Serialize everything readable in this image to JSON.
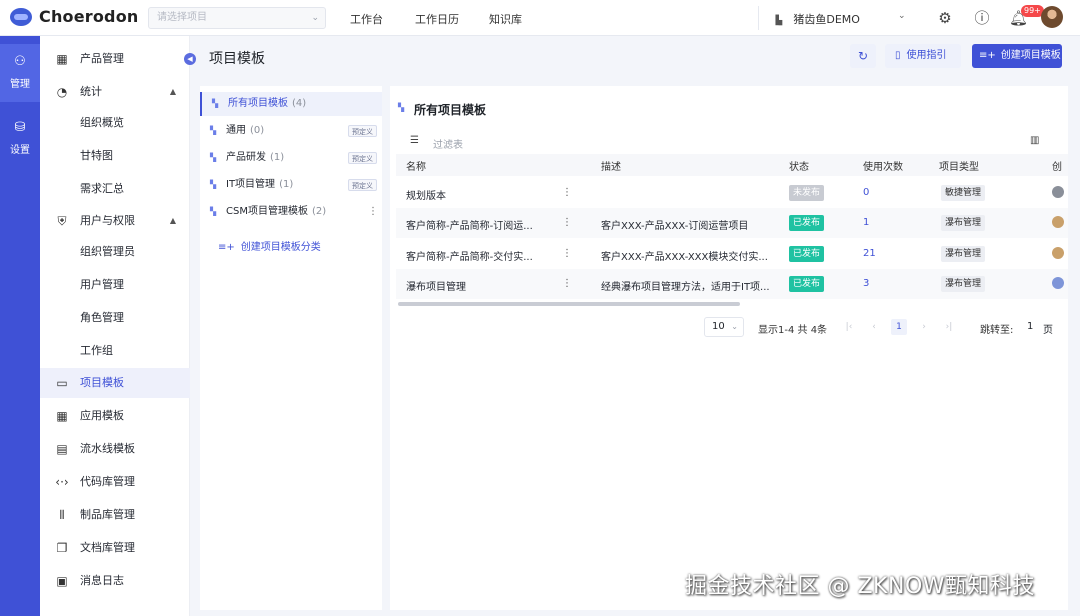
{
  "app": {
    "logo_text": "Choerodon"
  },
  "header": {
    "project_placeholder": "请选择项目",
    "nav": [
      "工作台",
      "工作日历",
      "知识库"
    ],
    "org_name": "猪齿鱼DEMO",
    "notification_count": "99+"
  },
  "rail": {
    "items": [
      {
        "label": "管理"
      },
      {
        "label": "设置"
      }
    ]
  },
  "sidebar": {
    "items": [
      {
        "label": "产品管理",
        "icon": "grid-icon"
      },
      {
        "label": "统计",
        "icon": "chart-icon",
        "expanded": true
      },
      {
        "label": "组织概览"
      },
      {
        "label": "甘特图"
      },
      {
        "label": "需求汇总"
      },
      {
        "label": "用户与权限",
        "icon": "shield-icon",
        "expanded": true
      },
      {
        "label": "组织管理员"
      },
      {
        "label": "用户管理"
      },
      {
        "label": "角色管理"
      },
      {
        "label": "工作组"
      },
      {
        "label": "项目模板",
        "icon": "template-icon",
        "active": true
      },
      {
        "label": "应用模板",
        "icon": "apps-icon"
      },
      {
        "label": "流水线模板",
        "icon": "pipeline-icon"
      },
      {
        "label": "代码库管理",
        "icon": "code-icon"
      },
      {
        "label": "制品库管理",
        "icon": "artifact-icon"
      },
      {
        "label": "文档库管理",
        "icon": "docs-icon"
      },
      {
        "label": "消息日志",
        "icon": "message-icon"
      }
    ]
  },
  "page": {
    "title": "项目模板",
    "refresh_label": "↻",
    "guide_label": "使用指引",
    "create_label": "创建项目模板"
  },
  "categories": {
    "items": [
      {
        "label": "所有项目模板",
        "count": "(4)",
        "active": true
      },
      {
        "label": "通用",
        "count": "(0)",
        "tag": "预定义"
      },
      {
        "label": "产品研发",
        "count": "(1)",
        "tag": "预定义"
      },
      {
        "label": "IT项目管理",
        "count": "(1)",
        "tag": "预定义"
      },
      {
        "label": "CSM项目管理模板",
        "count": "(2)"
      }
    ],
    "add_label": "创建项目模板分类"
  },
  "table": {
    "title": "所有项目模板",
    "filter_placeholder": "过滤表",
    "columns": [
      "名称",
      "描述",
      "状态",
      "使用次数",
      "项目类型",
      "创"
    ],
    "rows": [
      {
        "name": "规划版本",
        "desc": "",
        "status": "未发布",
        "count": "0",
        "type": "敏捷管理"
      },
      {
        "name": "客户简称-产品简称-订阅运...",
        "desc": "客户XXX-产品XXX-订阅运营项目",
        "status": "已发布",
        "count": "1",
        "type": "瀑布管理"
      },
      {
        "name": "客户简称-产品简称-交付实...",
        "desc": "客户XXX-产品XXX-XXX模块交付实...",
        "status": "已发布",
        "count": "21",
        "type": "瀑布管理"
      },
      {
        "name": "瀑布项目管理",
        "desc": "经典瀑布项目管理方法，适用于IT项...",
        "status": "已发布",
        "count": "3",
        "type": "瀑布管理"
      }
    ]
  },
  "pagination": {
    "page_size": "10",
    "info": "显示1-4 共 4条",
    "current": "1",
    "jump_label": "跳转至:",
    "jump_value": "1",
    "unit": "页"
  },
  "watermark": "掘金技术社区 @ ZKNOW甄知科技"
}
